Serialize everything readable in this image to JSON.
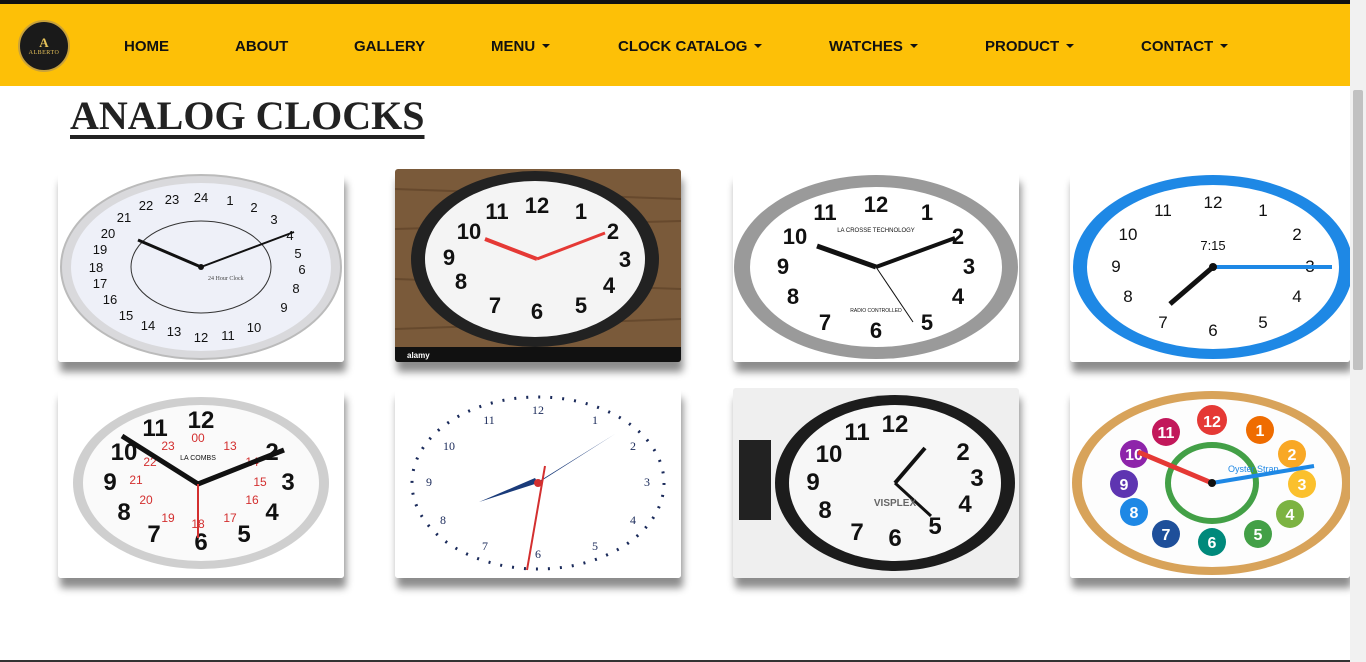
{
  "brand": {
    "letter": "A",
    "name": "ALBERTO"
  },
  "nav": {
    "home": "HOME",
    "about": "ABOUT",
    "gallery": "GALLERY",
    "menu": "MENU",
    "clock_catalog": "CLOCK CATALOG",
    "watches": "WATCHES",
    "product": "PRODUCT",
    "contact": "CONTACT"
  },
  "page": {
    "title": "ANALOG CLOCKS"
  },
  "clocks": [
    {
      "time": "",
      "brand": "24 Hour Clock"
    },
    {
      "time": "",
      "brand": "alamy"
    },
    {
      "time": "",
      "brand": "LA CROSSE TECHNOLOGY",
      "sub": "RADIO CONTROLLED"
    },
    {
      "time": "7:15",
      "brand": ""
    },
    {
      "time": "",
      "brand": "LA COMBS"
    },
    {
      "time": "",
      "brand": ""
    },
    {
      "time": "",
      "brand": "VISPLEX"
    },
    {
      "time": "",
      "brand": "Oyster Strap"
    }
  ],
  "colors": {
    "navbar": "#fdc007",
    "accent_blue": "#1e88e5",
    "accent_red": "#e53935"
  }
}
